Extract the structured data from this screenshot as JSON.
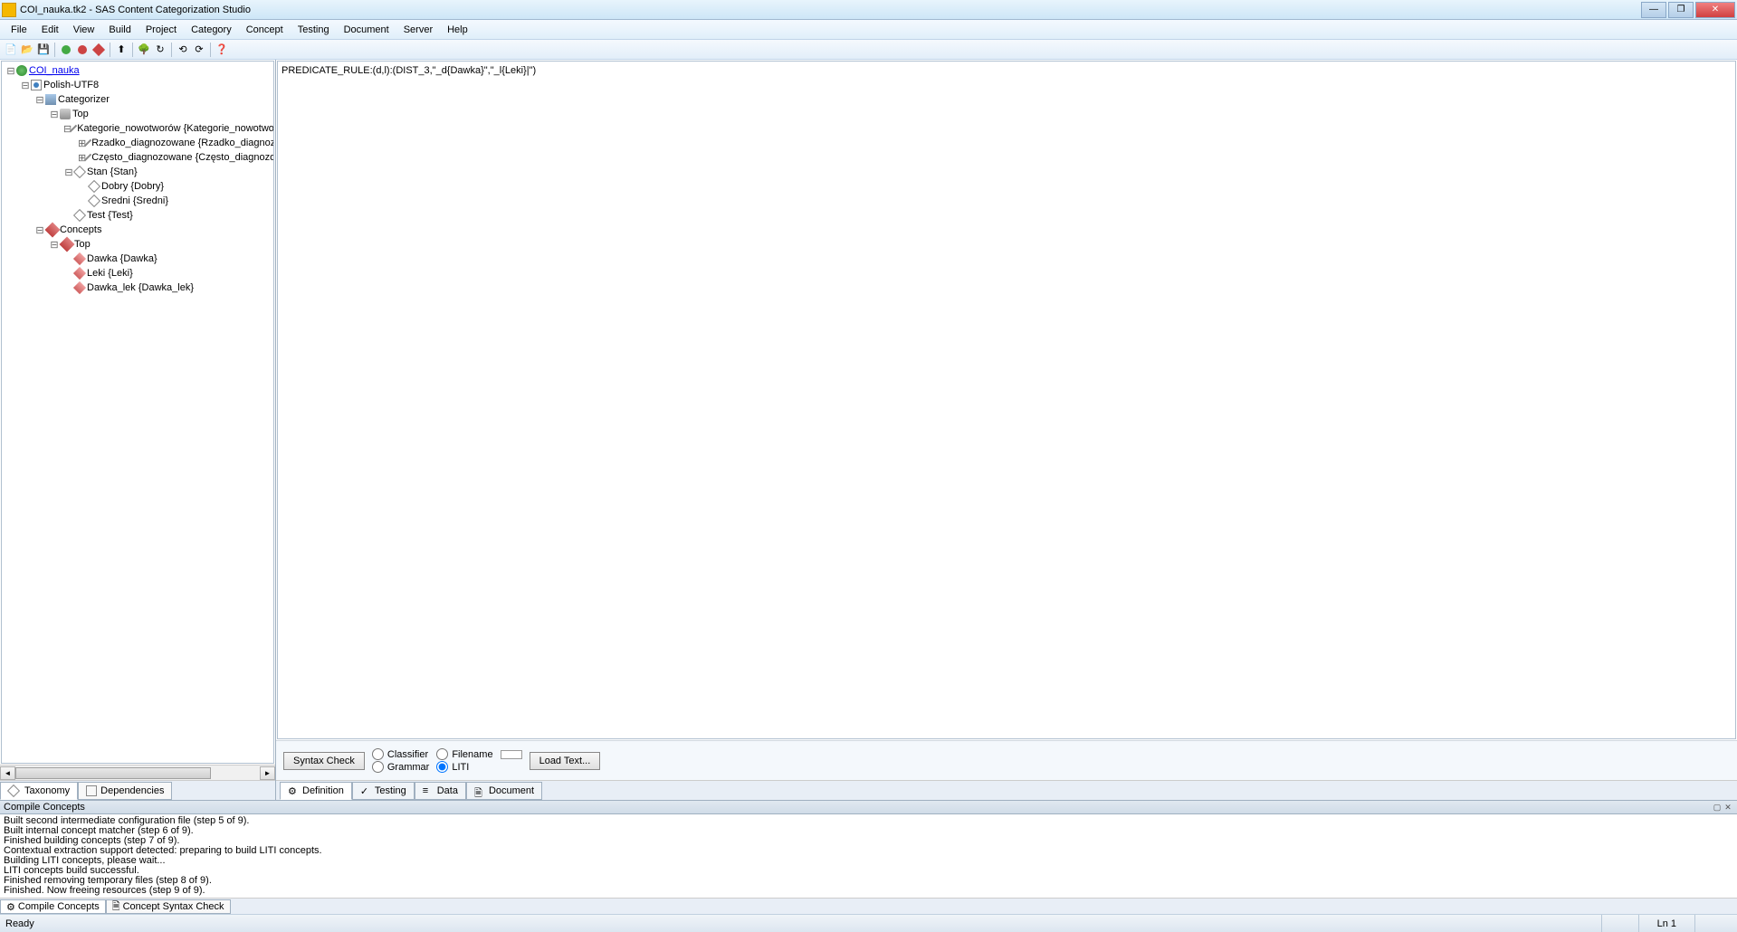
{
  "window": {
    "title": "COI_nauka.tk2 - SAS Content Categorization Studio"
  },
  "menu": {
    "items": [
      "File",
      "Edit",
      "View",
      "Build",
      "Project",
      "Category",
      "Concept",
      "Testing",
      "Document",
      "Server",
      "Help"
    ]
  },
  "tree": {
    "root": "COI_nauka",
    "lang": "Polish-UTF8",
    "categorizer": "Categorizer",
    "cat_top": "Top",
    "cat_items": [
      "Kategorie_nowotworów {Kategorie_nowotworów}",
      "Rzadko_diagnozowane {Rzadko_diagnozowane}",
      "Często_diagnozowane {Często_diagnozowane}"
    ],
    "stan": "Stan {Stan}",
    "stan_items": [
      "Dobry {Dobry}",
      "Sredni {Sredni}"
    ],
    "test": "Test {Test}",
    "concepts": "Concepts",
    "con_top": "Top",
    "con_items": [
      "Dawka {Dawka}",
      "Leki {Leki}",
      "Dawka_lek {Dawka_lek}"
    ]
  },
  "left_tabs": {
    "taxonomy": "Taxonomy",
    "dependencies": "Dependencies"
  },
  "editor": {
    "code": "PREDICATE_RULE:(d,l):(DIST_3,\"_d{Dawka}\",\"_l{Leki}|\")"
  },
  "options": {
    "syntax_check": "Syntax Check",
    "classifier": "Classifier",
    "grammar": "Grammar",
    "filename": "Filename",
    "liti": "LITI",
    "load_text": "Load Text..."
  },
  "right_tabs": {
    "definition": "Definition",
    "testing": "Testing",
    "data": "Data",
    "document": "Document"
  },
  "console": {
    "title": "Compile Concepts",
    "lines": [
      "Built second intermediate configuration file (step 5 of 9).",
      "Built internal concept matcher (step 6 of 9).",
      "Finished building concepts (step 7 of 9).",
      "Contextual extraction support detected: preparing to build LITI concepts.",
      "Building LITI concepts, please wait...",
      "LITI concepts build successful.",
      "Finished removing temporary files (step 8 of 9).",
      "Finished.  Now freeing resources (step 9 of 9)."
    ]
  },
  "console_tabs": {
    "compile": "Compile Concepts",
    "syntax": "Concept Syntax Check"
  },
  "status": {
    "ready": "Ready",
    "line": "Ln 1"
  }
}
